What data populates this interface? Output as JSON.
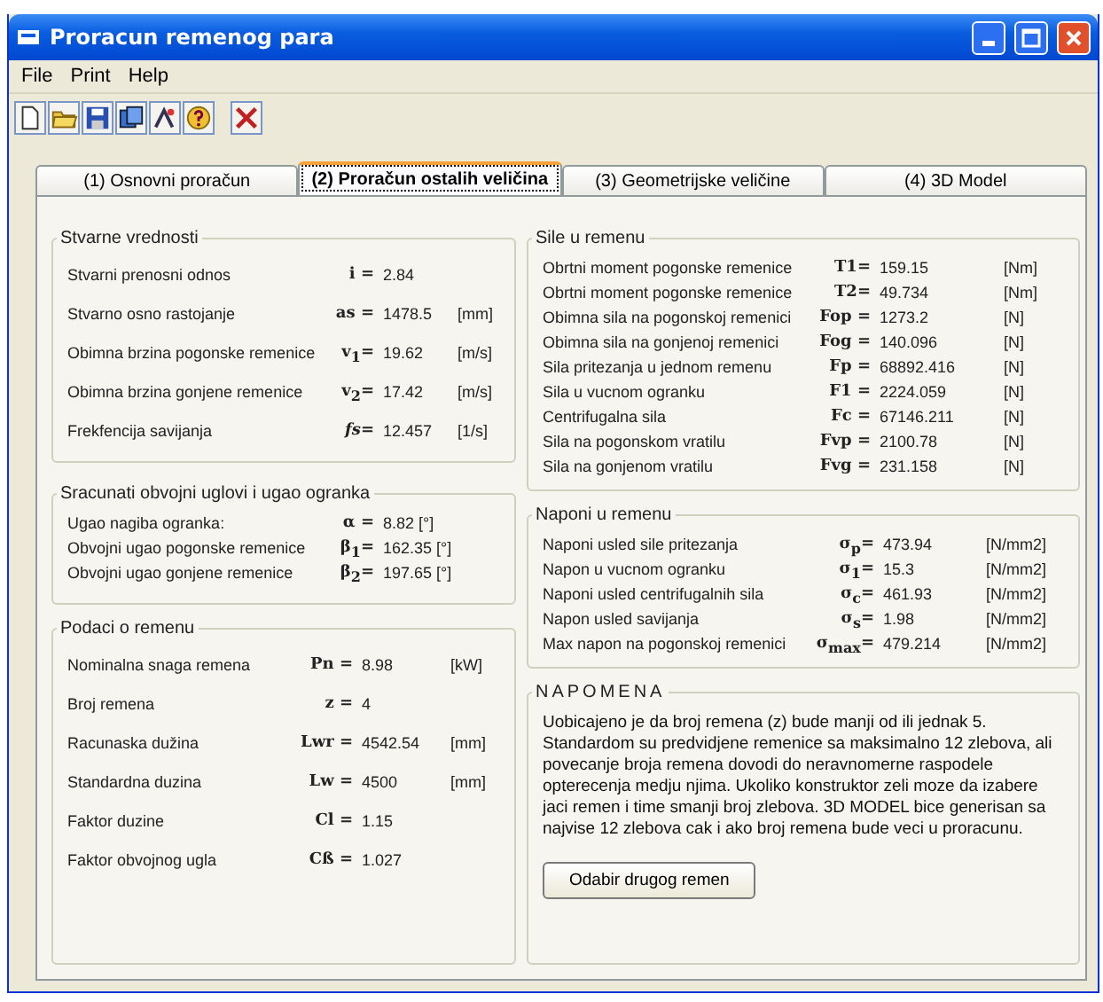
{
  "window": {
    "title": "Proracun remenog para"
  },
  "menu": [
    "File",
    "Print",
    "Help"
  ],
  "tabs": [
    {
      "label": "(1) Osnovni proračun",
      "selected": false
    },
    {
      "label": "(2) Proračun ostalih veličina",
      "selected": true
    },
    {
      "label": "(3) Geometrijske veličine",
      "selected": false
    },
    {
      "label": "(4) 3D Model",
      "selected": false
    }
  ],
  "left_groups": [
    {
      "title": "Stvarne vrednosti",
      "rows": [
        {
          "label": "Stvarni prenosni odnos",
          "symbol": "i  =",
          "value": "2.84"
        },
        {
          "label": "Stvarno osno rastojanje",
          "symbol": "as =",
          "value": "1478.5",
          "unit": "[mm]"
        },
        {
          "label": "Obimna brzina pogonske remenice",
          "symbol": "v$_{1}$=",
          "value": "19.62",
          "unit": "[m/s]"
        },
        {
          "label": "Obimna brzina gonjene remenice",
          "symbol": "v$_{2}$=",
          "value": "17.42",
          "unit": "[m/s]"
        },
        {
          "label": "Frekfencija savijanja",
          "symbol": "*fs*=",
          "value": "12.457",
          "unit": "[1/s]"
        }
      ]
    },
    {
      "title": "Sracunati obvojni uglovi i ugao ogranka",
      "rows": [
        {
          "label": "Ugao nagiba ogranka:",
          "symbol": "α =",
          "value": "8.82 [°]"
        },
        {
          "label": "Obvojni ugao pogonske remenice",
          "symbol": "β$_{1}$=",
          "value": "162.35 [°]"
        },
        {
          "label": "Obvojni ugao gonjene remenice",
          "symbol": "β$_{2}$=",
          "value": "197.65 [°]"
        }
      ]
    },
    {
      "title": "Podaci o remenu",
      "rows": [
        {
          "label": "Nominalna snaga remena",
          "symbol": "Pn =",
          "value": "8.98",
          "unit": "[kW]"
        },
        {
          "label": "Broj remena",
          "symbol": "z =",
          "value": "4"
        },
        {
          "label": "Racunaska dužina",
          "symbol": "Lwr =",
          "value": "4542.54",
          "unit": "[mm]"
        },
        {
          "label": "Standardna duzina",
          "symbol": "Lw  =",
          "value": "4500",
          "unit": "[mm]"
        },
        {
          "label": "Faktor duzine",
          "symbol": "Cl =",
          "value": "1.15"
        },
        {
          "label": "Faktor obvojnog ugla",
          "symbol": "Cß =",
          "value": "1.027"
        }
      ]
    }
  ],
  "right_groups": [
    {
      "title": "Sile u remenu",
      "rows": [
        {
          "label": "Obrtni moment pogonske remenice",
          "symbol": "T1=",
          "value": "159.15",
          "unit": "[Nm]"
        },
        {
          "label": "Obrtni moment pogonske remenice",
          "symbol": "T2=",
          "value": "49.734",
          "unit": "[Nm]"
        },
        {
          "label": "Obimna sila na pogonskoj remenici",
          "symbol": "Fop =",
          "value": "1273.2",
          "unit": "[N]"
        },
        {
          "label": "Obimna sila na gonjenoj remenici",
          "symbol": "Fog =",
          "value": "140.096",
          "unit": "[N]"
        },
        {
          "label": "Sila pritezanja u jednom remenu",
          "symbol": "Fp =",
          "value": "68892.416",
          "unit": "[N]"
        },
        {
          "label": "Sila u vucnom ogranku",
          "symbol": "F1 =",
          "value": "2224.059",
          "unit": "[N]"
        },
        {
          "label": "Centrifugalna sila",
          "symbol": "Fc =",
          "value": "67146.211",
          "unit": "[N]"
        },
        {
          "label": "Sila na pogonskom vratilu",
          "symbol": "Fvp =",
          "value": "2100.78",
          "unit": "[N]"
        },
        {
          "label": "Sila na gonjenom vratilu",
          "symbol": "Fvg =",
          "value": "231.158",
          "unit": "[N]"
        }
      ]
    },
    {
      "title": "Naponi u remenu",
      "rows": [
        {
          "label": "Naponi usled sile pritezanja",
          "symbol": "σ$_{p}$=",
          "value": "473.94",
          "unit": "[N/mm2]"
        },
        {
          "label": "Napon u vucnom ogranku",
          "symbol": "σ$_{1}$=",
          "value": "15.3",
          "unit": "[N/mm2]"
        },
        {
          "label": "Naponi usled centrifugalnih sila",
          "symbol": "σ$_{c}$=",
          "value": "461.93",
          "unit": "[N/mm2]"
        },
        {
          "label": "Napon usled savijanja",
          "symbol": "σ$_{s}$=",
          "value": "1.98",
          "unit": "[N/mm2]"
        },
        {
          "label": "Max napon na pogonskoj remenici",
          "symbol": "σ$_{max}$=",
          "value": "479.214",
          "unit": "[N/mm2]"
        }
      ]
    }
  ],
  "note": {
    "title": "NAPOMENA",
    "text": "Uobicajeno je da broj remena (z) bude manji od ili jednak 5. Standardom su predvidjene remenice sa maksimalno 12 zlebova, ali povecanje broja remena dovodi do neravnomerne raspodele opterecenja medju njima. Ukoliko konstruktor zeli moze da izabere jaci remen i time smanji broj zlebova. 3D MODEL bice generisan sa najvise 12 zlebova cak i ako broj remena bude veci u proracunu.",
    "button": "Odabir drugog remen"
  }
}
